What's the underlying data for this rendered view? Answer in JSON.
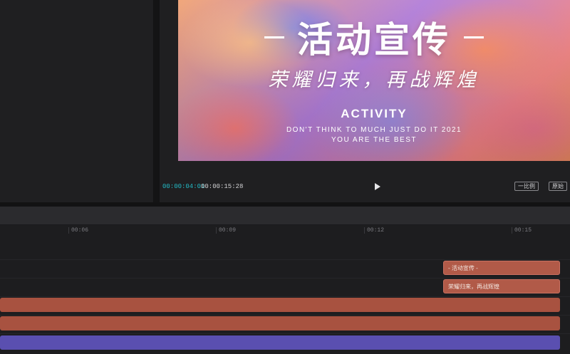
{
  "player": {
    "preview": {
      "title": "活动宣传",
      "subtitle": "荣耀归来，再战辉煌",
      "activity": "ACTIVITY",
      "tagline1": "DON'T THINK TO MUCH JUST DO IT 2021",
      "tagline2": "YOU ARE THE BEST"
    },
    "time_current": "00:00:04:01",
    "time_total": "00:00:15:28",
    "play_icon": "play-icon",
    "button1_label": "一比例",
    "button2_label": "原始"
  },
  "timeline": {
    "ruler_ticks": [
      "00:06",
      "00:09",
      "00:12",
      "00:15"
    ],
    "tracks": [
      {
        "clip_label": "- 活动宣传 -",
        "kind": "text"
      },
      {
        "clip_label": "荣耀归来，再战辉煌",
        "kind": "text"
      },
      {
        "clip_label": "",
        "kind": "video"
      },
      {
        "clip_label": "",
        "kind": "video"
      },
      {
        "clip_label": "",
        "kind": "audio"
      }
    ]
  },
  "colors": {
    "accent_time": "#23b9c4",
    "clip_red": "#a85240",
    "clip_purple": "#5a4fb0"
  }
}
